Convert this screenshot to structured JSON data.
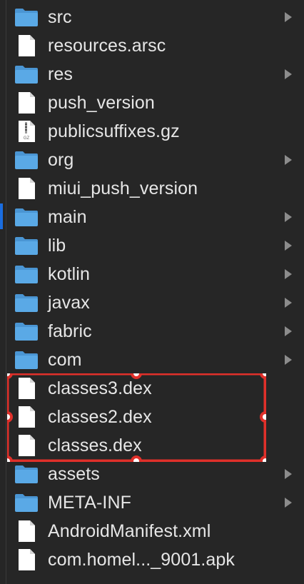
{
  "items": [
    {
      "name": "src",
      "kind": "folder",
      "expandable": true
    },
    {
      "name": "resources.arsc",
      "kind": "file",
      "expandable": false
    },
    {
      "name": "res",
      "kind": "folder",
      "expandable": true
    },
    {
      "name": "push_version",
      "kind": "file",
      "expandable": false
    },
    {
      "name": "publicsuffixes.gz",
      "kind": "archive",
      "expandable": false,
      "badge": "GZ"
    },
    {
      "name": "org",
      "kind": "folder",
      "expandable": true
    },
    {
      "name": "miui_push_version",
      "kind": "file",
      "expandable": false
    },
    {
      "name": "main",
      "kind": "folder",
      "expandable": true
    },
    {
      "name": "lib",
      "kind": "folder",
      "expandable": true
    },
    {
      "name": "kotlin",
      "kind": "folder",
      "expandable": true
    },
    {
      "name": "javax",
      "kind": "folder",
      "expandable": true
    },
    {
      "name": "fabric",
      "kind": "folder",
      "expandable": true
    },
    {
      "name": "com",
      "kind": "folder",
      "expandable": true
    },
    {
      "name": "classes3.dex",
      "kind": "file",
      "expandable": false
    },
    {
      "name": "classes2.dex",
      "kind": "file",
      "expandable": false
    },
    {
      "name": "classes.dex",
      "kind": "file",
      "expandable": false
    },
    {
      "name": "assets",
      "kind": "folder",
      "expandable": true
    },
    {
      "name": "META-INF",
      "kind": "folder",
      "expandable": true
    },
    {
      "name": "AndroidManifest.xml",
      "kind": "file",
      "expandable": false
    },
    {
      "name": "com.homel..._9001.apk",
      "kind": "file",
      "expandable": false
    }
  ],
  "icons": {
    "folder": "folder-icon",
    "file": "document-icon",
    "archive": "gz-archive-icon",
    "chevron": "chevron-right-icon"
  },
  "colors": {
    "background": "#262626",
    "text": "#e6e6e6",
    "folder": "#5aa9e6",
    "folder_tab": "#4a95d3",
    "document": "#ffffff",
    "chevron": "#8c8c8c",
    "annotation": "#e0302a",
    "selection_marker": "#1a6de0"
  },
  "annotation": {
    "label": "highlighted dex files",
    "covers": [
      "classes3.dex",
      "classes2.dex",
      "classes.dex"
    ]
  }
}
